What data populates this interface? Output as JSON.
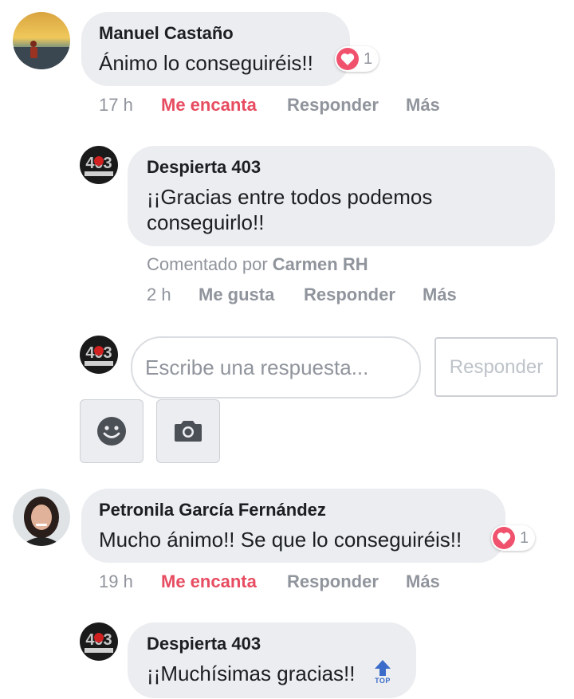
{
  "comments": [
    {
      "author": "Manuel Castaño",
      "text": "Ánimo lo conseguiréis!!",
      "reaction_count": "1",
      "time": "17 h",
      "reaction_label": "Me encanta",
      "reply_label": "Responder",
      "more_label": "Más"
    },
    {
      "author": "Despierta 403",
      "text": "¡¡Gracias entre todos podemos conseguirlo!!",
      "commented_by_prefix": "Comentado por",
      "commented_by_name": "Carmen RH",
      "time": "2 h",
      "reaction_label": "Me gusta",
      "reply_label": "Responder",
      "more_label": "Más"
    },
    {
      "author": "Petronila García Fernández",
      "text": "Mucho ánimo!! Se que lo conseguiréis!!",
      "reaction_count": "1",
      "time": "19 h",
      "reaction_label": "Me encanta",
      "reply_label": "Responder",
      "more_label": "Más"
    },
    {
      "author": "Despierta 403",
      "text": "¡¡Muchísimas gracias!!",
      "top_label": "TOP"
    }
  ],
  "reply_box": {
    "placeholder": "Escribe una respuesta...",
    "submit_label": "Responder"
  },
  "avatar_logo_text": "403",
  "colors": {
    "love": "#e74c60",
    "bubble": "#ebedf0",
    "meta": "#90949c",
    "top_icon": "#3b6cc9"
  },
  "icons": [
    "heart-icon",
    "smiley-icon",
    "camera-icon",
    "top-arrow-icon"
  ]
}
